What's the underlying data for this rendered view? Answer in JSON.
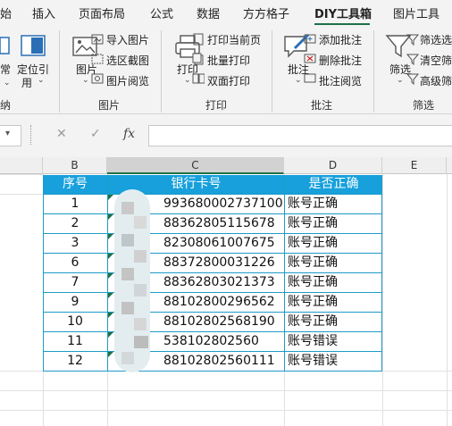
{
  "ribbon_tabs": [
    "始",
    "插入",
    "页面布局",
    "公式",
    "数据",
    "方方格子",
    "DIY工具箱",
    "图片工具"
  ],
  "active_tab": "DIY工具箱",
  "ribbon": {
    "group1": {
      "label": "纳",
      "buttons": [
        "常",
        "定位引",
        "用"
      ]
    },
    "picture": {
      "label": "图片",
      "big_button": "图片",
      "items": [
        "导入图片",
        "选区截图",
        "图片阅览"
      ]
    },
    "print": {
      "label": "打印",
      "big_button": "打印",
      "items": [
        "打印当前页",
        "批量打印",
        "双面打印"
      ]
    },
    "comment": {
      "label": "批注",
      "big_button": "批注",
      "items": [
        "添加批注",
        "删除批注",
        "批注阅览"
      ]
    },
    "filter": {
      "label": "筛选",
      "big_button": "筛选",
      "items": [
        "筛选选",
        "清空筛",
        "高级筛"
      ]
    }
  },
  "formula_bar": {
    "fx_label": "fx",
    "cancel": "✕",
    "confirm": "✓",
    "value": ""
  },
  "columns": [
    "B",
    "C",
    "D",
    "E"
  ],
  "table": {
    "headers": [
      "序号",
      "银行卡号",
      "是否正确"
    ],
    "rows": [
      {
        "no": "1",
        "card": "993680002737100",
        "status": "账号正确"
      },
      {
        "no": "2",
        "card": "88362805115678",
        "status": "账号正确"
      },
      {
        "no": "3",
        "card": "82308061007675",
        "status": "账号正确"
      },
      {
        "no": "6",
        "card": "88372800031226",
        "status": "账号正确"
      },
      {
        "no": "7",
        "card": "88362803021373",
        "status": "账号正确"
      },
      {
        "no": "9",
        "card": "88102800296562",
        "status": "账号正确"
      },
      {
        "no": "10",
        "card": "88102802568190",
        "status": "账号正确"
      },
      {
        "no": "11",
        "card": "538102802560",
        "status": "账号错误"
      },
      {
        "no": "12",
        "card": "88102802560111",
        "status": "账号错误"
      }
    ]
  },
  "colors": {
    "accent_green": "#1e7145",
    "table_header": "#17a0dc",
    "table_border": "#1e9bc6"
  }
}
